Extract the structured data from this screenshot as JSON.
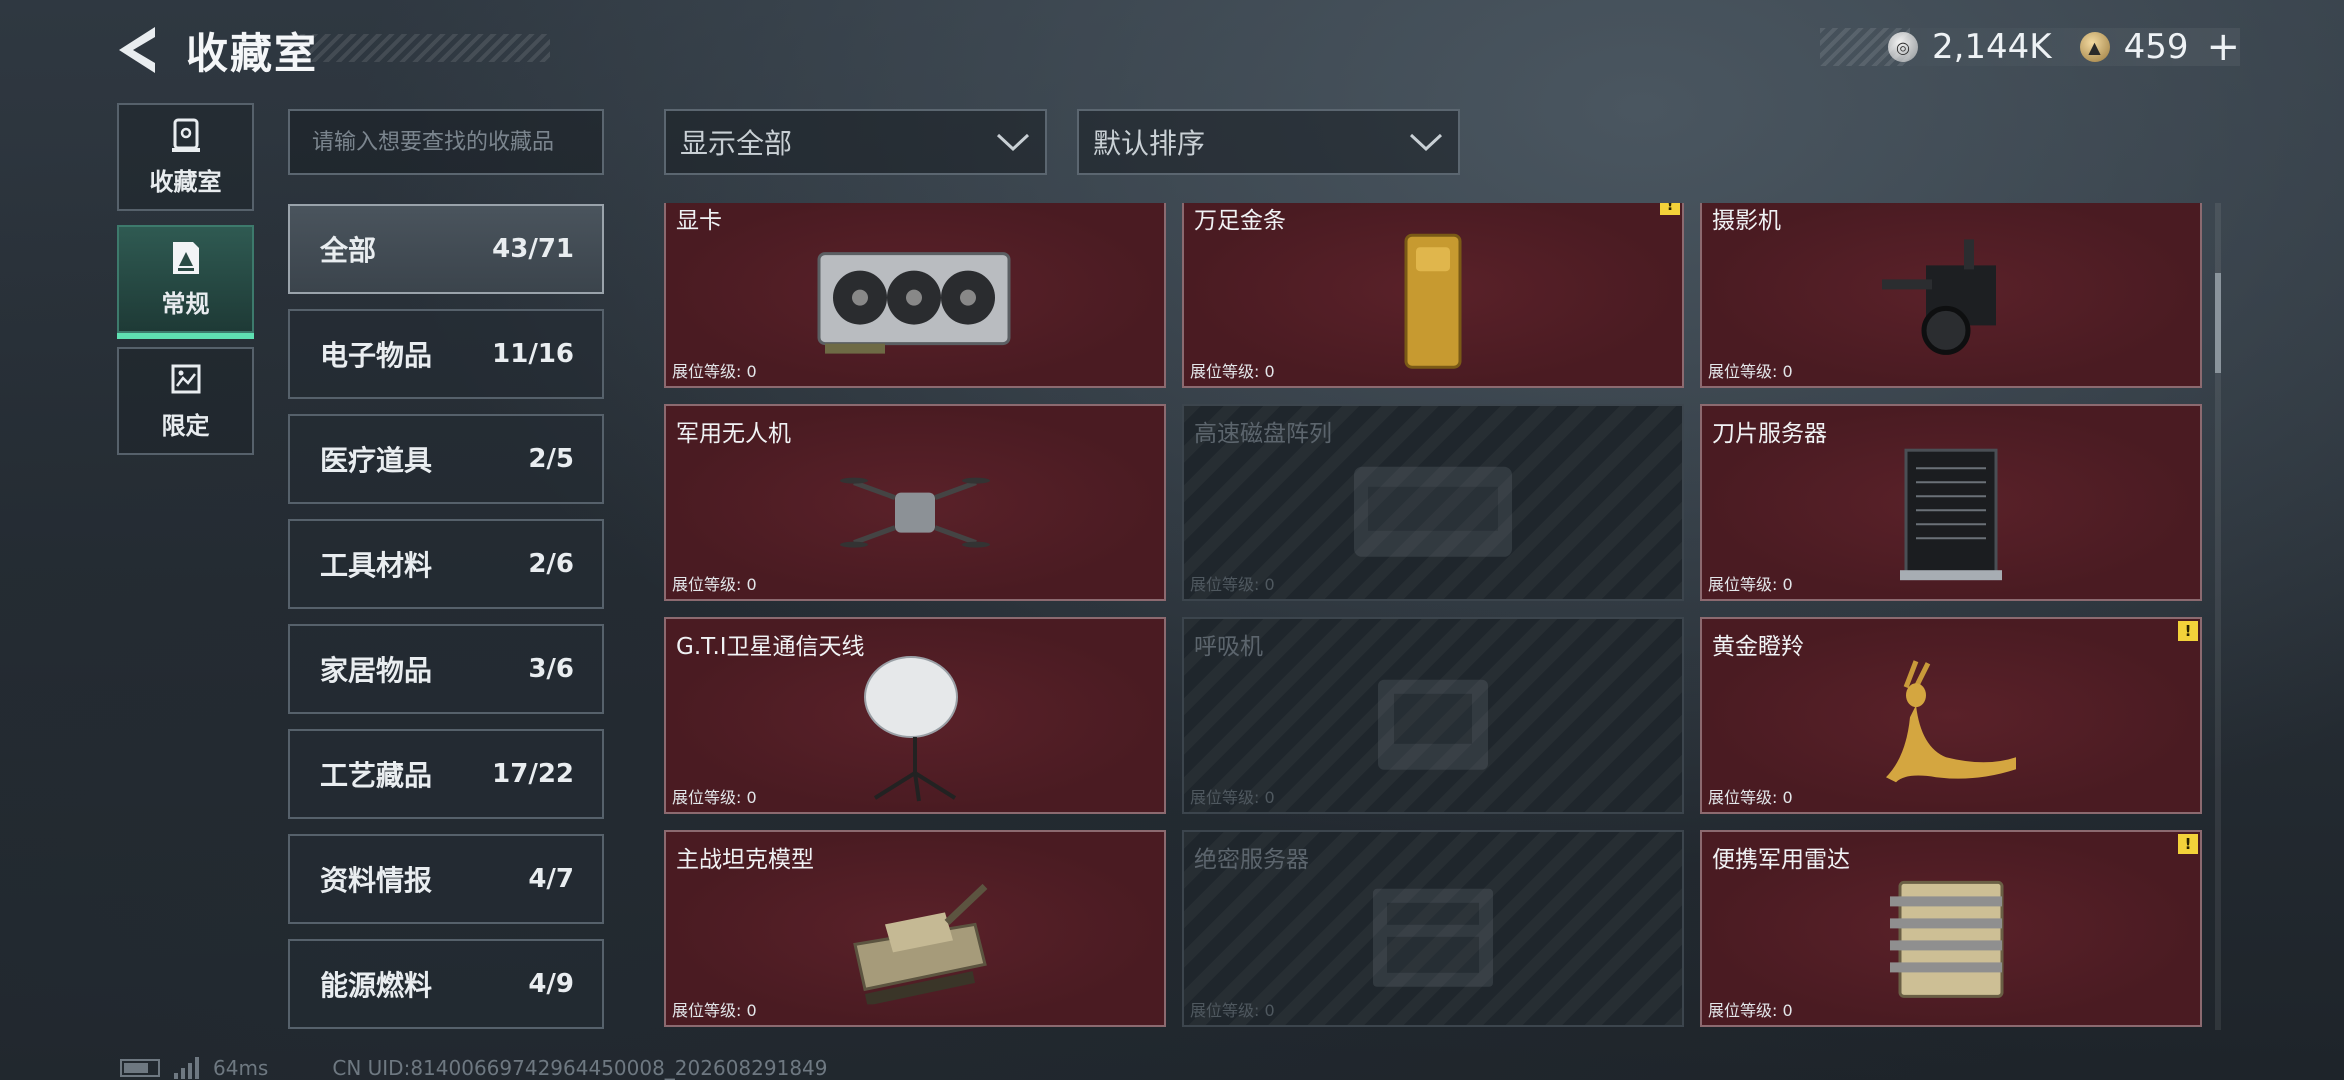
{
  "header": {
    "title": "收藏室",
    "currency": [
      {
        "icon": "silver-coin-icon",
        "value": "2,144K"
      },
      {
        "icon": "gold-coin-icon",
        "value": "459"
      }
    ],
    "add_label": "+"
  },
  "leftnav": [
    {
      "label": "收藏室",
      "icon": "collection-room-icon",
      "active": false
    },
    {
      "label": "常规",
      "icon": "regular-icon",
      "active": true
    },
    {
      "label": "限定",
      "icon": "limited-icon",
      "active": false
    }
  ],
  "search": {
    "placeholder": "请输入想要查找的收藏品",
    "value": ""
  },
  "categories": [
    {
      "label": "全部",
      "count": "43/71",
      "active": true
    },
    {
      "label": "电子物品",
      "count": "11/16"
    },
    {
      "label": "医疗道具",
      "count": "2/5"
    },
    {
      "label": "工具材料",
      "count": "2/6"
    },
    {
      "label": "家居物品",
      "count": "3/6"
    },
    {
      "label": "工艺藏品",
      "count": "17/22"
    },
    {
      "label": "资料情报",
      "count": "4/7"
    },
    {
      "label": "能源燃料",
      "count": "4/9"
    }
  ],
  "filters": {
    "show": "显示全部",
    "sort": "默认排序"
  },
  "level_label": "展位等级: 0",
  "items": [
    {
      "name": "显卡",
      "icon": "graphics-card-icon",
      "locked": false,
      "alert": false
    },
    {
      "name": "万足金条",
      "icon": "gold-bar-icon",
      "locked": false,
      "alert": true
    },
    {
      "name": "摄影机",
      "icon": "camera-icon",
      "locked": false,
      "alert": false
    },
    {
      "name": "军用无人机",
      "icon": "drone-icon",
      "locked": false,
      "alert": false
    },
    {
      "name": "高速磁盘阵列",
      "icon": "disk-array-icon",
      "locked": true,
      "alert": false
    },
    {
      "name": "刀片服务器",
      "icon": "blade-server-icon",
      "locked": false,
      "alert": false
    },
    {
      "name": "G.T.I卫星通信天线",
      "icon": "satellite-dish-icon",
      "locked": false,
      "alert": false
    },
    {
      "name": "呼吸机",
      "icon": "ventilator-icon",
      "locked": true,
      "alert": false
    },
    {
      "name": "黄金瞪羚",
      "icon": "golden-gazelle-icon",
      "locked": false,
      "alert": true
    },
    {
      "name": "主战坦克模型",
      "icon": "tank-model-icon",
      "locked": false,
      "alert": false
    },
    {
      "name": "绝密服务器",
      "icon": "secret-server-icon",
      "locked": true,
      "alert": false
    },
    {
      "name": "便携军用雷达",
      "icon": "portable-radar-icon",
      "locked": false,
      "alert": true
    }
  ],
  "alert_mark": "!",
  "footer": {
    "ping": "64ms",
    "uid": "CN UID:81400669742964450008_202608291849"
  }
}
